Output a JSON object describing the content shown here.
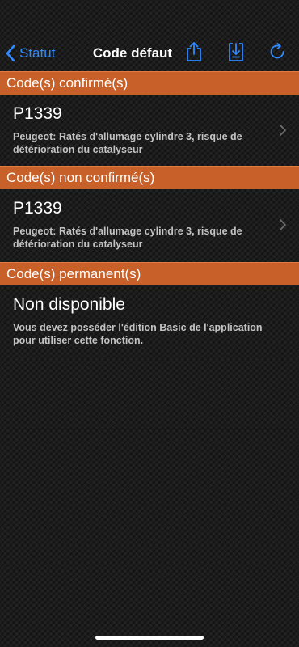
{
  "nav": {
    "back_label": "Statut",
    "title": "Code défaut",
    "accent_color": "#2f8bff",
    "icons": [
      "share-icon",
      "download-icon",
      "refresh-icon"
    ]
  },
  "sections": [
    {
      "header": "Code(s) confirmé(s)",
      "code": "P1339",
      "description": "Peugeot: Ratés d'allumage cylindre 3, risque de détérioration du catalyseur"
    },
    {
      "header": "Code(s) non confirmé(s)",
      "code": "P1339",
      "description": "Peugeot: Ratés d'allumage cylindre 3, risque de détérioration du catalyseur"
    },
    {
      "header": "Code(s) permanent(s)",
      "code": "Non disponible",
      "description": "Vous devez posséder l'édition Basic de l'application pour utiliser cette fonction."
    }
  ],
  "colors": {
    "section_header": "#c8602a",
    "background": "#1c1c1c"
  }
}
